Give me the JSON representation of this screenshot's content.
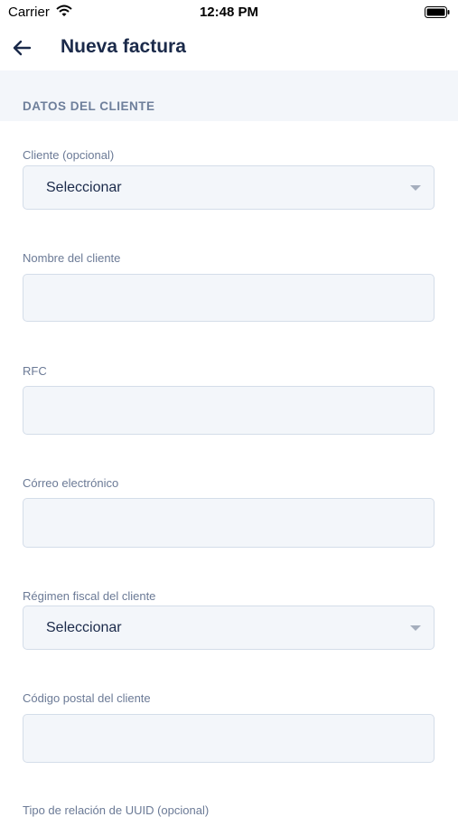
{
  "status_bar": {
    "carrier": "Carrier",
    "time": "12:48 PM"
  },
  "header": {
    "title": "Nueva factura"
  },
  "section": {
    "title": "DATOS DEL CLIENTE"
  },
  "fields": {
    "cliente": {
      "label": "Cliente (opcional)",
      "value": "Seleccionar"
    },
    "nombre": {
      "label": "Nombre del cliente",
      "value": ""
    },
    "rfc": {
      "label": "RFC",
      "value": ""
    },
    "correo": {
      "label": "Córreo electrónico",
      "value": ""
    },
    "regimen": {
      "label": "Régimen fiscal del cliente",
      "value": "Seleccionar"
    },
    "codigo_postal": {
      "label": "Código postal del cliente",
      "value": ""
    },
    "tipo_relacion": {
      "label": "Tipo de relación de UUID (opcional)"
    }
  },
  "colors": {
    "accent": "#1b2a4a",
    "field_bg": "#f3f6fa",
    "label": "#6b7a96"
  }
}
